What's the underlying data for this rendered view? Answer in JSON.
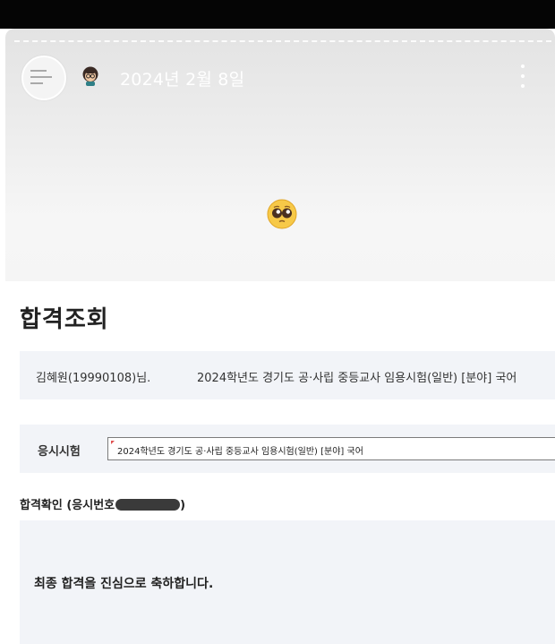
{
  "story": {
    "date": "2024년 2월 8일",
    "more_icon": "more-vertical-icon",
    "avatar_icon": "profile-thumbnail",
    "memoji_icon": "memoji-girl-icon",
    "sticker_icon": "pleading-face-emoji"
  },
  "page": {
    "title": "합격조회"
  },
  "info": {
    "name": "김혜원(19990108)님.",
    "exam": "2024학년도 경기도 공·사립 중등교사 임용시험(일반) [분야] 국어"
  },
  "exam_select": {
    "label": "응시시험",
    "value": "2024학년도 경기도 공·사립 중등교사 임용시험(일반) [분야] 국어"
  },
  "result": {
    "label_prefix": "합격확인 (응시번호",
    "label_suffix": ")",
    "message": "최종 합격을 진심으로 축하합니다."
  },
  "colors": {
    "top_bar": "#050505",
    "panel_bg": "#f2f4f8",
    "text": "#222222"
  }
}
